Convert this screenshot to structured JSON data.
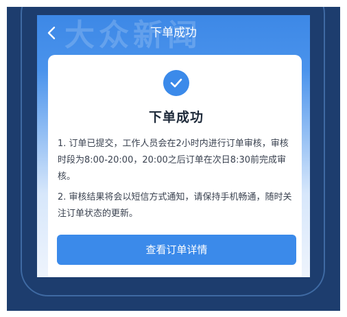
{
  "header": {
    "title": "下单成功",
    "back_icon": "chevron-left-icon"
  },
  "background": {
    "watermark": "大众新闻"
  },
  "card": {
    "status_icon": "check-circle-icon",
    "title": "下单成功",
    "paragraphs": [
      "1. 订单已提交，工作人员会在2小时内进行订单审核，审核时段为8:00-20:00，20:00之后订单在次日8:30前完成审核。",
      "2. 审核结果将会以短信方式通知，请保持手机畅通，随时关注订单状态的更新。"
    ],
    "button_label": "查看订单详情"
  },
  "colors": {
    "accent": "#3b8aea",
    "frame_background": "#1d3d6e",
    "header_background": "#3d88e6",
    "indicator": "#d9363e"
  }
}
